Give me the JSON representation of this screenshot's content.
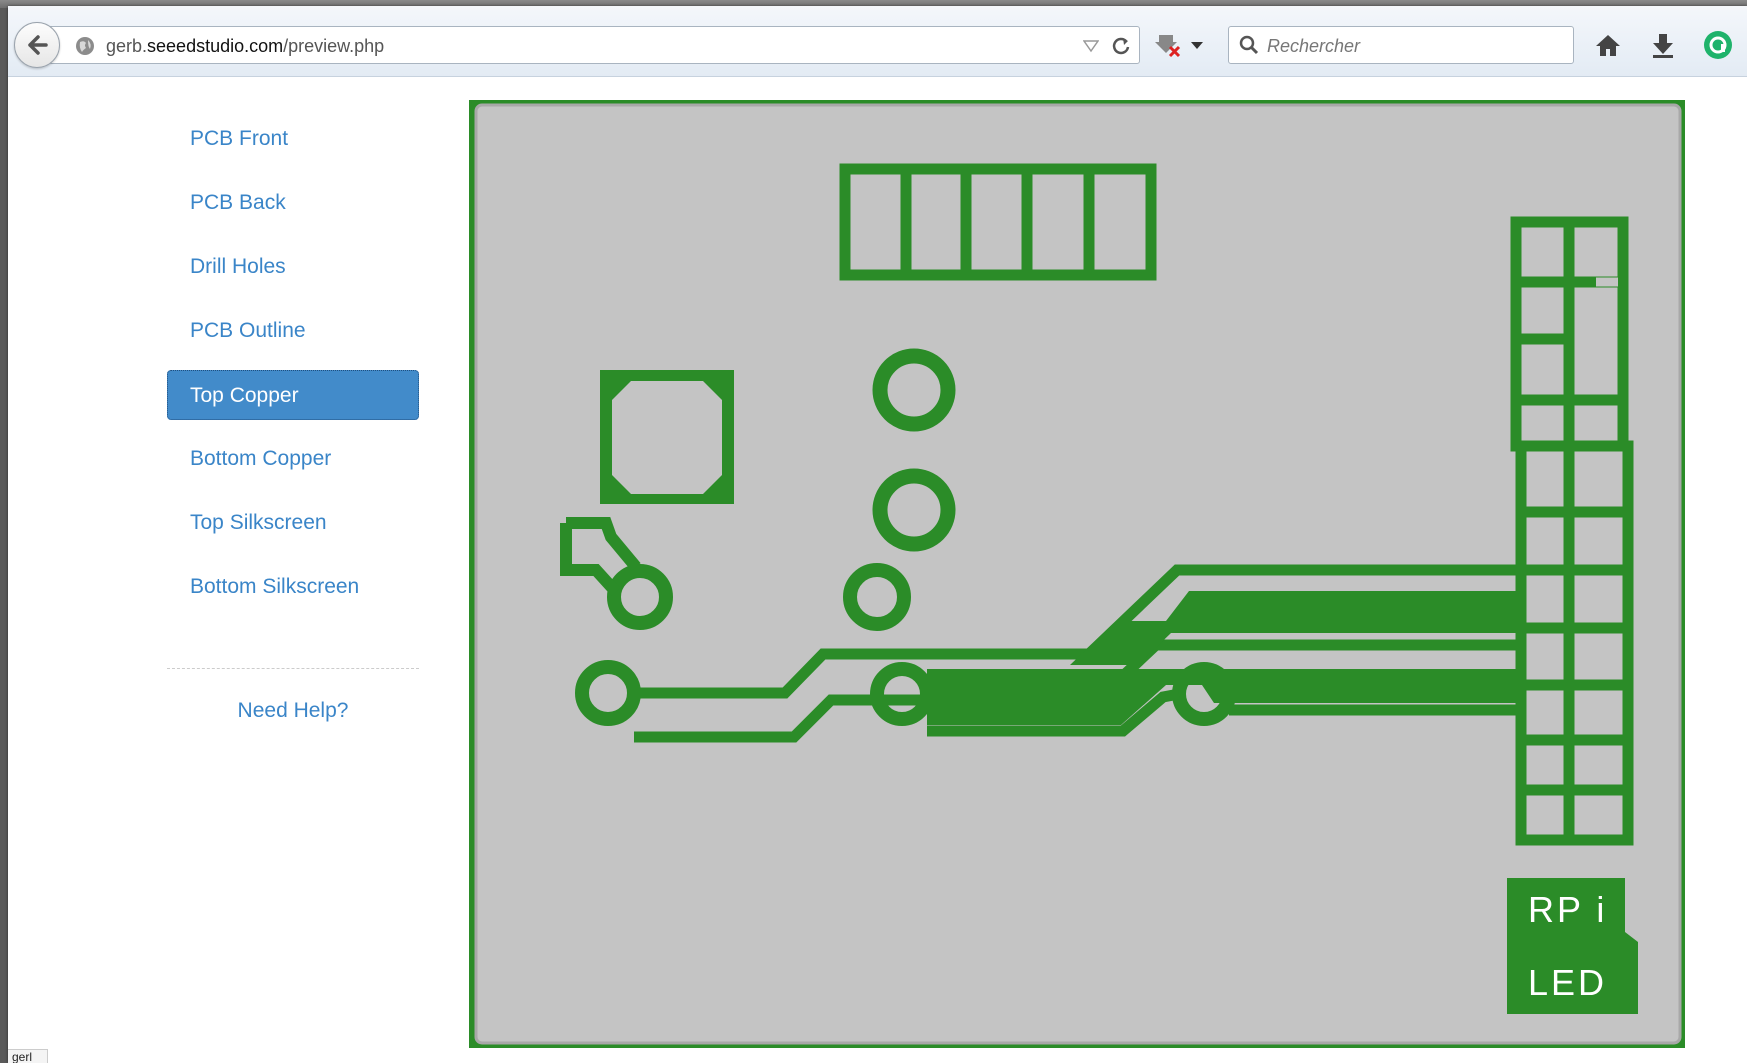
{
  "browser": {
    "url_host_prefix": "gerb.",
    "url_host_main": "seeedstudio.com",
    "url_path": "/preview.php",
    "search_placeholder": "Rechercher"
  },
  "sidebar": {
    "items": [
      {
        "label": "PCB Front",
        "active": false
      },
      {
        "label": "PCB Back",
        "active": false
      },
      {
        "label": "Drill Holes",
        "active": false
      },
      {
        "label": "PCB Outline",
        "active": false
      },
      {
        "label": "Top Copper",
        "active": true
      },
      {
        "label": "Bottom Copper",
        "active": false
      },
      {
        "label": "Top Silkscreen",
        "active": false
      },
      {
        "label": "Bottom Silkscreen",
        "active": false
      }
    ],
    "help_label": "Need Help?"
  },
  "preview": {
    "label_line1": "RP i",
    "label_line2": "LED"
  },
  "status_bar": {
    "text": "gerl"
  },
  "colors": {
    "copper": "#2b8c28",
    "board": "#c4c4c4",
    "active_nav": "#428bca",
    "link": "#3a85c8"
  }
}
